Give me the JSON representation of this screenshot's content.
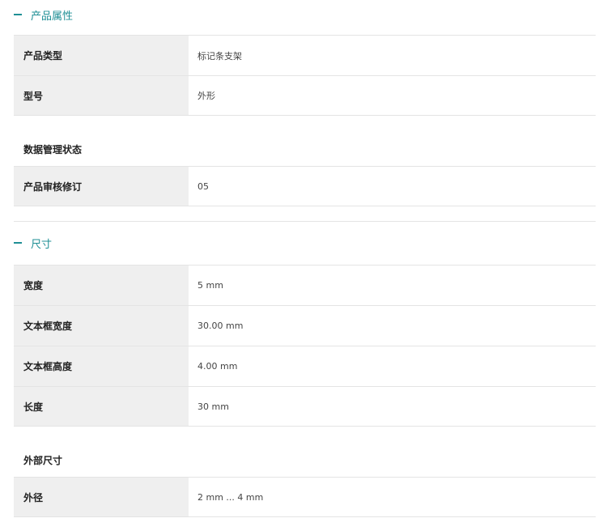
{
  "sections": [
    {
      "title": "产品属性",
      "rows": [
        {
          "label": "产品类型",
          "value": "标记条支架"
        },
        {
          "label": "型号",
          "value": "外形"
        }
      ],
      "subheading": "数据管理状态",
      "subrows": [
        {
          "label": "产品审核修订",
          "value": "05"
        }
      ]
    },
    {
      "title": "尺寸",
      "rows": [
        {
          "label": "宽度",
          "value": "5 mm"
        },
        {
          "label": "文本框宽度",
          "value": "30.00 mm"
        },
        {
          "label": "文本框高度",
          "value": "4.00 mm"
        },
        {
          "label": "长度",
          "value": "30 mm"
        }
      ],
      "subheading": "外部尺寸",
      "subrows": [
        {
          "label": "外径",
          "value": "2 mm ... 4 mm"
        }
      ]
    }
  ],
  "colors": {
    "accent": "#1f8f95",
    "label_bg": "#efefef",
    "border": "#e4e4e4"
  },
  "icons": {
    "collapse": "minus-icon"
  }
}
